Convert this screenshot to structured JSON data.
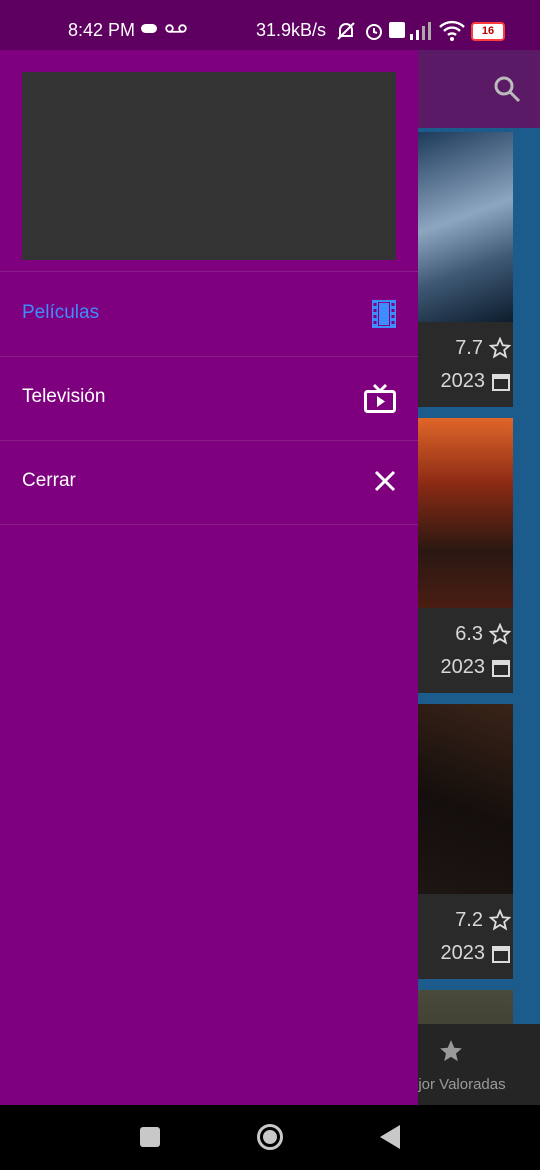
{
  "status_bar": {
    "time": "8:42 PM",
    "speed": "31.9kB/s",
    "battery": "16"
  },
  "drawer": {
    "menu": [
      {
        "label": "Películas",
        "icon": "movie-film-icon",
        "active": true
      },
      {
        "label": "Televisión",
        "icon": "tv-icon",
        "active": false
      },
      {
        "label": "Cerrar",
        "icon": "close-icon",
        "active": false
      }
    ],
    "active_color": "#3d8dff",
    "background_color": "#7e007f"
  },
  "background_app": {
    "cards": [
      {
        "rating": "7.7",
        "year": "2023"
      },
      {
        "rating": "6.3",
        "year": "2023"
      },
      {
        "rating": "7.2",
        "year": "2023"
      }
    ],
    "bottom_nav_label": "ejor Valoradas"
  }
}
